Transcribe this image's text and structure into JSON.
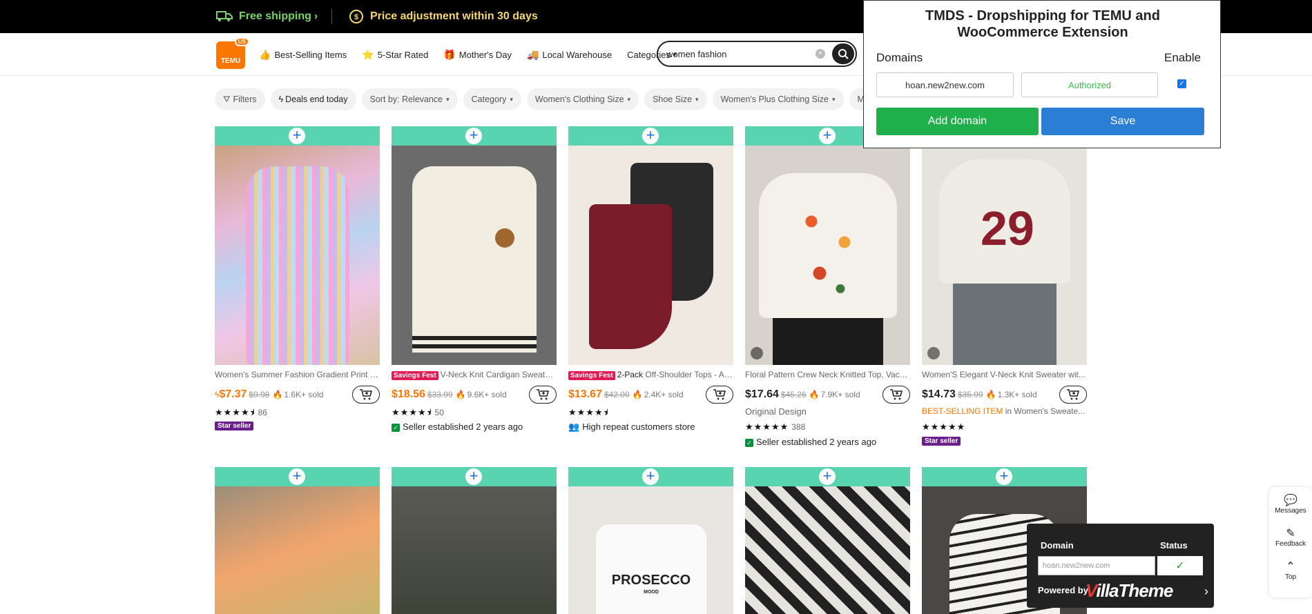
{
  "topbar": {
    "free_shipping": "Free shipping",
    "price_adjust": "Price adjustment within 30 days"
  },
  "header": {
    "logo_text": "TEMU",
    "logo_region": "US",
    "nav": [
      {
        "label": "Best-Selling Items",
        "icon": "thumbs-up-icon"
      },
      {
        "label": "5-Star Rated",
        "icon": "star-badge-icon"
      },
      {
        "label": "Mother's Day",
        "icon": "gift-icon"
      },
      {
        "label": "Local Warehouse",
        "icon": "truck-icon"
      },
      {
        "label": "Categories",
        "icon": "chevron-down-icon"
      }
    ],
    "search_value": "women fashion"
  },
  "filters": [
    "Filters",
    "Deals end today",
    "Sort by: Relevance",
    "Category",
    "Women's Clothing Size",
    "Shoe Size",
    "Women's Plus Clothing Size",
    "Men's"
  ],
  "products": [
    {
      "title": "Women's Summer Fashion Gradient Print S...",
      "prefix": "",
      "badge": "",
      "price": "$7.37",
      "old_price": "$9.98",
      "sold": "1.6K+ sold",
      "rating_count": "86",
      "extra": "",
      "tag": "Star seller"
    },
    {
      "title": "V-Neck Knit Cardigan Sweater...",
      "prefix": "",
      "badge": "Savings Fest",
      "price": "$18.56",
      "old_price": "$33.99",
      "sold": "9.6K+ sold",
      "rating_count": "50",
      "extra": "",
      "tag": "Seller established 2 years ago"
    },
    {
      "title": "Off-Shoulder Tops - As...",
      "prefix": "2-Pack",
      "badge": "Savings Fest",
      "price": "$13.67",
      "old_price": "$42.00",
      "sold": "2.4K+ sold",
      "rating_count": "",
      "extra": "",
      "tag": "High repeat customers store"
    },
    {
      "title": "Floral Pattern Crew Neck Knitted Top, Vaca...",
      "prefix": "",
      "badge": "",
      "price": "$17.64",
      "old_price": "$45.26",
      "sold": "7.9K+ sold",
      "rating_count": "388",
      "extra": "Original Design",
      "tag": "Seller established 2 years ago"
    },
    {
      "title": "Women'S Elegant V-Neck Knit Sweater wit...",
      "prefix": "",
      "badge": "",
      "price": "$14.73",
      "old_price": "$35.99",
      "sold": "1.3K+ sold",
      "rating_count": "",
      "extra_highlight": "BEST-SELLING ITEM",
      "extra_rest": "in Women's Sweate...",
      "tag": "Star seller"
    }
  ],
  "second_row_print": "PROSECCO",
  "second_row_print_sub": "MOOD",
  "extension": {
    "title_line1": "TMDS - Dropshipping for TEMU and",
    "title_line2": "WooCommerce Extension",
    "domains_label": "Domains",
    "enable_label": "Enable",
    "domain_value": "hoan.new2new.com",
    "status_value": "Authorized",
    "add_button": "Add domain",
    "save_button": "Save",
    "colors": {
      "add": "#20b04b",
      "save": "#2a7fd4",
      "authorized": "#3dbb4a"
    }
  },
  "sidebar": {
    "messages": "Messages",
    "feedback": "Feedback",
    "top": "Top"
  },
  "status_popup": {
    "domain_header": "Domain",
    "status_header": "Status",
    "domain_value": "hoan.new2new.com",
    "powered_by": "Powered by",
    "brand_part1": "V",
    "brand_part2": "illaTheme"
  }
}
